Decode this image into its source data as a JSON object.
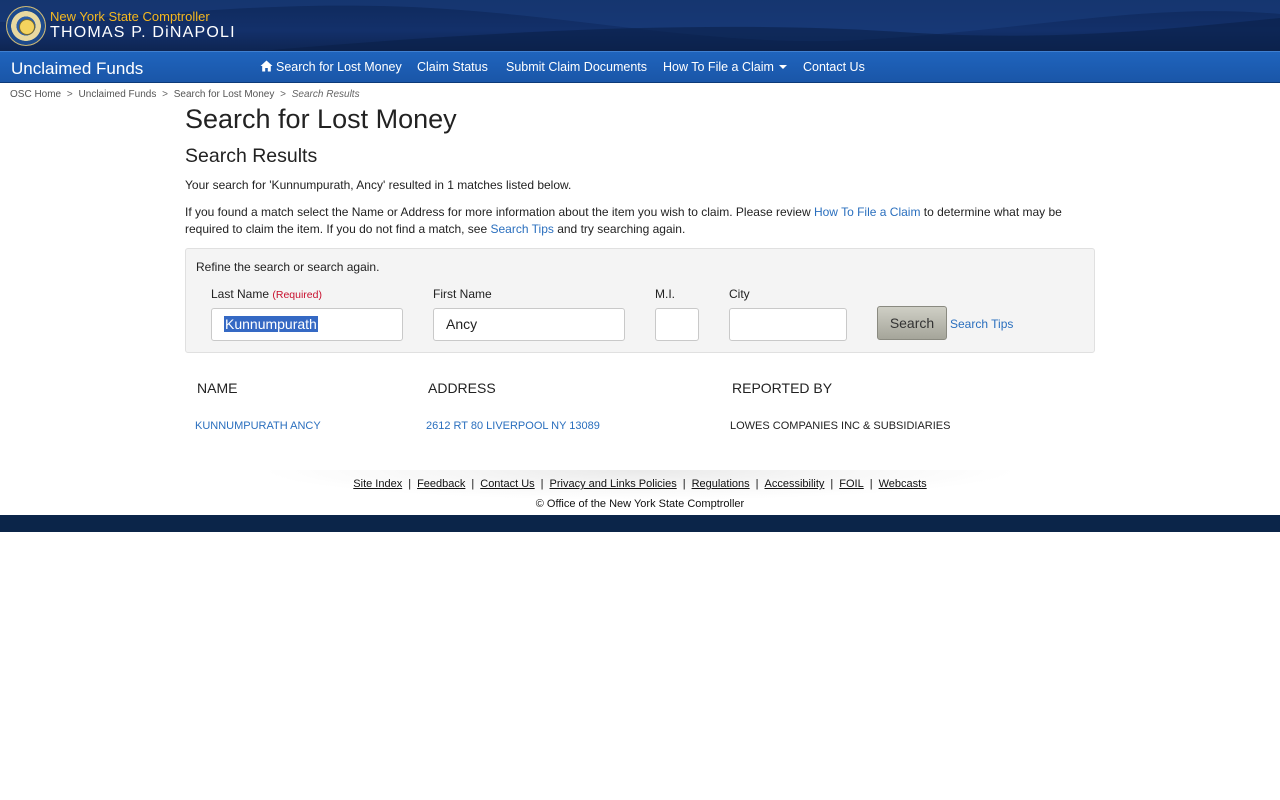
{
  "header": {
    "title_line1": "New York State Comptroller",
    "title_line2": "THOMAS P. DiNAPOLI"
  },
  "nav": {
    "brand": "Unclaimed Funds",
    "items": [
      {
        "label": "Search for Lost Money",
        "icon": "home-icon"
      },
      {
        "label": "Claim Status"
      },
      {
        "label": "Submit Claim Documents"
      },
      {
        "label": "How To File a Claim",
        "icon": "caret-down-icon"
      },
      {
        "label": "Contact Us"
      }
    ]
  },
  "breadcrumb": {
    "items": [
      "OSC Home",
      "Unclaimed Funds",
      "Search for Lost Money"
    ],
    "separator": ">",
    "current": "Search Results"
  },
  "main": {
    "title": "Search for Lost Money",
    "subtitle": "Search Results",
    "summary": "Your search for 'Kunnumpurath, Ancy' resulted in 1 matches listed below.",
    "instructions": {
      "part1": "If you found a match select the Name or Address for more information about the item you wish to claim. Please review ",
      "link1": "How To File a Claim",
      "part2": " to determine what may be required to claim the item. If you do not find a match, see ",
      "link2": "Search Tips",
      "part3": " and try searching again."
    }
  },
  "search_panel": {
    "title": "Refine the search or search again.",
    "last_name_label": "Last Name",
    "required_label": "(Required)",
    "last_name_value": "Kunnumpurath",
    "first_name_label": "First Name",
    "first_name_value": "Ancy",
    "mi_label": "M.I.",
    "mi_value": "",
    "city_label": "City",
    "city_value": "",
    "search_button": "Search",
    "tips_link": "Search Tips"
  },
  "results": {
    "columns": [
      "NAME",
      "ADDRESS",
      "REPORTED BY"
    ],
    "rows": [
      {
        "name": "KUNNUMPURATH ANCY",
        "address": "2612 RT 80 LIVERPOOL NY 13089",
        "reported_by": "LOWES COMPANIES INC & SUBSIDIARIES"
      }
    ]
  },
  "footer": {
    "links": [
      "Site Index",
      "Feedback",
      "Contact Us",
      "Privacy and Links Policies",
      "Regulations",
      "Accessibility",
      "FOIL",
      "Webcasts"
    ],
    "copyright": "© Office of the New York State Comptroller"
  },
  "colors": {
    "header_bg": "#0f2a5c",
    "nav_bg": "#1f64bd",
    "title_gold": "#f5b820",
    "link_blue": "#2a6fbe",
    "required_red": "#c8102e",
    "footer_bar": "#0b2549"
  }
}
